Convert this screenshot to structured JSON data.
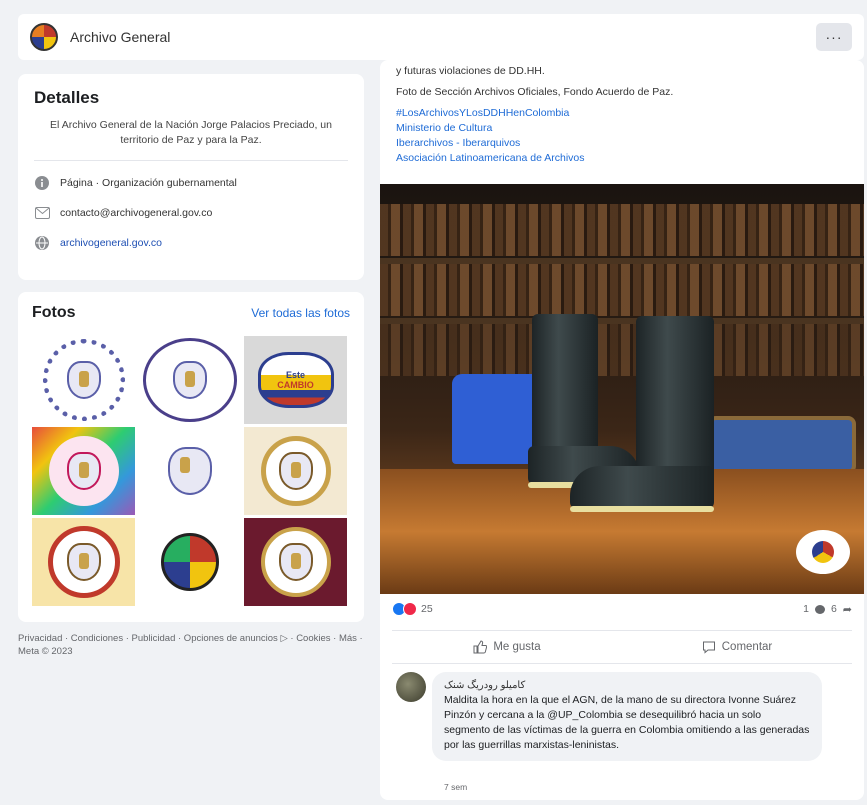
{
  "header": {
    "page_name": "Archivo General",
    "more_label": "···"
  },
  "details": {
    "title": "Detalles",
    "bio": "El Archivo General de la Nación Jorge Palacios Preciado, un territorio de Paz y para la Paz.",
    "category": "Página · Organización gubernamental",
    "email": "contacto@archivogeneral.gov.co",
    "website": "archivogeneral.gov.co"
  },
  "photos": {
    "title": "Fotos",
    "see_all": "Ver todas las fotos",
    "tile_text": [
      "Este",
      "CAMBIO"
    ]
  },
  "footer": {
    "text": "Privacidad · Condiciones · Publicidad · Opciones de anuncios ▷ · Cookies · Más · Meta © 2023"
  },
  "post": {
    "lines": [
      "y futuras violaciones de DD.HH.",
      "Foto de Sección Archivos Oficiales, Fondo Acuerdo de Paz."
    ],
    "hashtags": [
      "#LosArchivosYLosDDHHenColombia",
      "Ministerio de Cultura",
      "Iberarchivos - Iberarquivos",
      "Asociación Latinoamericana de Archivos"
    ],
    "reactions_count": "25",
    "comments_count": "1",
    "shares_count": "6",
    "like_label": "Me gusta",
    "comment_label": "Comentar"
  },
  "comment": {
    "author": "کامیلو رودریگ شنک",
    "text": "Maldita la hora en la que el AGN, de la mano de su directora Ivonne Suárez Pinzón y cercana a la @UP_Colombia se desequilibró hacia un solo segmento de las víctimas de la guerra en Colombia omitiendo a las generadas por las guerrillas marxistas-leninistas.",
    "time": "7 sem"
  },
  "colors": {
    "link": "#1e6bd6",
    "background": "#f0f2f5",
    "like_blue": "#1877f2",
    "love_red": "#f02849"
  }
}
